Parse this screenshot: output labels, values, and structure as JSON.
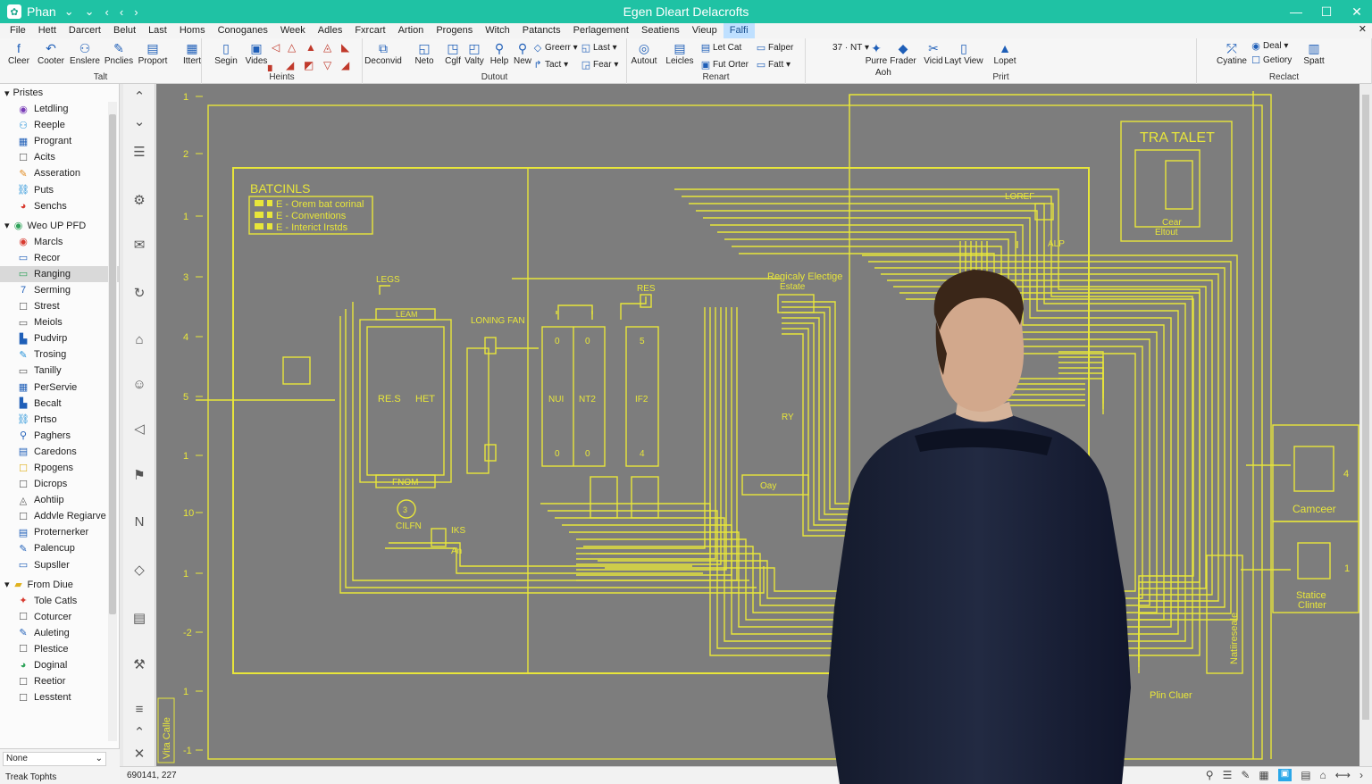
{
  "window": {
    "app_name": "Phan",
    "title": "Egen Dleart Delacrofts",
    "min": "—",
    "max": "☐",
    "close": "✕"
  },
  "menu": {
    "items": [
      "File",
      "Hett",
      "Darcert",
      "Belut",
      "Last",
      "Homs",
      "Conoganes",
      "Week",
      "Adles",
      "Fxrcart",
      "Artion",
      "Progens",
      "Witch",
      "Patancts",
      "Perlagement",
      "Seatiens",
      "Vieup",
      "Falfi"
    ],
    "active_index": 17,
    "close_glyph": "✕"
  },
  "ribbon": {
    "groups": [
      {
        "label": "Talt"
      },
      {
        "label": "Heints"
      },
      {
        "label": "Dutout"
      },
      {
        "label": "Renart"
      },
      {
        "label": "Prirt"
      },
      {
        "label": "Reclact"
      }
    ],
    "buttons": [
      {
        "label": "Cleer",
        "icon": "f"
      },
      {
        "label": "Cooter",
        "icon": "↶"
      },
      {
        "label": "Enslere",
        "icon": "⚇"
      },
      {
        "label": "Pnclies",
        "icon": "✎"
      },
      {
        "label": "Proport",
        "icon": "▤"
      },
      {
        "label": "Ittert",
        "icon": "▦"
      },
      {
        "label": "Segin",
        "icon": "▯"
      },
      {
        "label": "Vides",
        "icon": "▣"
      },
      {
        "label": "Deconvid",
        "icon": "⧉"
      },
      {
        "label": "Neto",
        "icon": "◱"
      },
      {
        "label": "Cglf",
        "icon": "◳"
      },
      {
        "label": "Valty",
        "icon": "◰"
      },
      {
        "label": "Help",
        "icon": "⚲"
      },
      {
        "label": "New",
        "icon": "⚲"
      },
      {
        "label": "Autout",
        "icon": "◎"
      },
      {
        "label": "Leicles",
        "icon": "▤"
      },
      {
        "label": "Purre",
        "icon": "✦"
      },
      {
        "label": "Frader",
        "icon": "◆"
      },
      {
        "label": "Vicid",
        "icon": "✂"
      },
      {
        "label": "Layt View",
        "icon": "▯"
      },
      {
        "label": "Lopet",
        "icon": "▲"
      },
      {
        "label": "Cyatine",
        "icon": "⤱"
      },
      {
        "label": "Spatt",
        "icon": "▥"
      }
    ],
    "small_buttons": [
      {
        "label": "Greerr ▾",
        "icon": "◇"
      },
      {
        "label": "Last ▾",
        "icon": "◱"
      },
      {
        "label": "Tact ▾",
        "icon": "↱"
      },
      {
        "label": "Fear ▾",
        "icon": "◲"
      },
      {
        "label": "Let Cat",
        "icon": "▤"
      },
      {
        "label": "Fut Orter",
        "icon": "▣"
      },
      {
        "label": "Falper",
        "icon": "▭"
      },
      {
        "label": "Fatt ▾",
        "icon": "▭"
      },
      {
        "label": "37 · NT ▾",
        "icon": ""
      },
      {
        "label": "Deal ▾",
        "icon": "◉"
      },
      {
        "label": "Getiory",
        "icon": "☐"
      },
      {
        "label": "Aoh",
        "icon": ""
      }
    ]
  },
  "sidebar": {
    "sections": [
      {
        "title": "Pristes",
        "items": [
          {
            "label": "Letdling",
            "icon": "◉",
            "color": "#7a3db8"
          },
          {
            "label": "Reeple",
            "icon": "⚇",
            "color": "#1f8fd8"
          },
          {
            "label": "Progrant",
            "icon": "▦",
            "color": "#1f5fb8"
          },
          {
            "label": "Acits",
            "icon": "☐",
            "color": "#555555"
          },
          {
            "label": "Asseration",
            "icon": "✎",
            "color": "#e08a1f"
          },
          {
            "label": "Puts",
            "icon": "⛓",
            "color": "#1f8fd8"
          },
          {
            "label": "Senchs",
            "icon": "◕",
            "color": "#d83a2f"
          }
        ]
      },
      {
        "title": "Weo UP PFD",
        "items": [
          {
            "label": "Marcls",
            "icon": "◉",
            "color": "#d83a2f"
          },
          {
            "label": "Recor",
            "icon": "▭",
            "color": "#1f5fb8"
          },
          {
            "label": "Ranging",
            "icon": "▭",
            "color": "#2fa35a",
            "selected": true
          },
          {
            "label": "Serming",
            "icon": "7",
            "color": "#1f5fb8"
          },
          {
            "label": "Strest",
            "icon": "☐",
            "color": "#555555"
          },
          {
            "label": "Meiols",
            "icon": "▭",
            "color": "#555555"
          },
          {
            "label": "Pudvirp",
            "icon": "▙",
            "color": "#1f5fb8"
          },
          {
            "label": "Trosing",
            "icon": "✎",
            "color": "#1f8fd8"
          },
          {
            "label": "Tanilly",
            "icon": "▭",
            "color": "#555555"
          },
          {
            "label": "PerServie",
            "icon": "▦",
            "color": "#1f5fb8"
          },
          {
            "label": "Becalt",
            "icon": "▙",
            "color": "#1f5fb8"
          },
          {
            "label": "Prtso",
            "icon": "⛓",
            "color": "#1f8fd8"
          },
          {
            "label": "Paghers",
            "icon": "⚲",
            "color": "#1f5fb8"
          },
          {
            "label": "Caredons",
            "icon": "▤",
            "color": "#1f5fb8"
          },
          {
            "label": "Rpogens",
            "icon": "☐",
            "color": "#e0b21f"
          },
          {
            "label": "Dicrops",
            "icon": "☐",
            "color": "#555555"
          },
          {
            "label": "Aohtiip",
            "icon": "◬",
            "color": "#555555"
          },
          {
            "label": "Addvle Regiarve",
            "icon": "☐",
            "color": "#555555"
          },
          {
            "label": "Proternerker",
            "icon": "▤",
            "color": "#1f5fb8"
          },
          {
            "label": "Palencup",
            "icon": "✎",
            "color": "#1f5fb8"
          },
          {
            "label": "Supsller",
            "icon": "▭",
            "color": "#1f5fb8"
          }
        ]
      },
      {
        "title": "From Diue",
        "items": [
          {
            "label": "Tole Catls",
            "icon": "✦",
            "color": "#d83a2f"
          },
          {
            "label": "Coturcer",
            "icon": "☐",
            "color": "#555555"
          },
          {
            "label": "Auleting",
            "icon": "✎",
            "color": "#1f5fb8"
          },
          {
            "label": "Plestice",
            "icon": "☐",
            "color": "#555555"
          },
          {
            "label": "Doginal",
            "icon": "◕",
            "color": "#2fa35a"
          },
          {
            "label": "Reetior",
            "icon": "☐",
            "color": "#555555"
          },
          {
            "label": "Lesstent",
            "icon": "☐",
            "color": "#555555"
          }
        ]
      }
    ],
    "footer_select": "None",
    "footer_status": "Treak Tophts"
  },
  "statusbar": {
    "coords": "690141, 227"
  },
  "canvas": {
    "colors": {
      "background": "#7d7d7d",
      "line": "#e8e63a",
      "text": "#e8e63a"
    },
    "ruler_labels": [
      "1",
      "2",
      "1",
      "3",
      "4",
      "5",
      "1",
      "10",
      "1",
      "-2",
      "1",
      "-1"
    ],
    "side_label": "Vita Calle",
    "labels": {
      "batcinls": "BATCINLS",
      "legend_1": "E - Orem bat corinal",
      "legend_2": "E - Conventions",
      "legend_3": "E - Interict Irstds",
      "legs": "LEGS",
      "leam": "LEAM",
      "res_s": "RE.S",
      "het": "HET",
      "fnom": "FNOM",
      "loning_fan": "LONING FAN",
      "res": "RES",
      "nui": "NUI",
      "nt2": "NT2",
      "if2": "IF2",
      "cell_0a": "0",
      "cell_0b": "0",
      "cell_0c": "0",
      "cell_0d": "0",
      "cell_5": "5",
      "cell_4": "4",
      "cilfn": "CILFN",
      "iks": "IKS",
      "an": "An",
      "regically": "Regicaly Electige",
      "estate": "Estate",
      "loref": "LOREF",
      "alp": "ALP",
      "ry": "RY",
      "oay": "Oay",
      "tra_talet": "TRA TALET",
      "cear_elfout": "Eltout",
      "cear": "Cear",
      "camceer": "Camceer",
      "statice": "Statice",
      "clinter": "Clinter",
      "num_4": "4",
      "num_1": "1",
      "naturescale": "Natiireseale",
      "plin_cluer": "Plin Cluer",
      "circle_3": "3"
    }
  }
}
